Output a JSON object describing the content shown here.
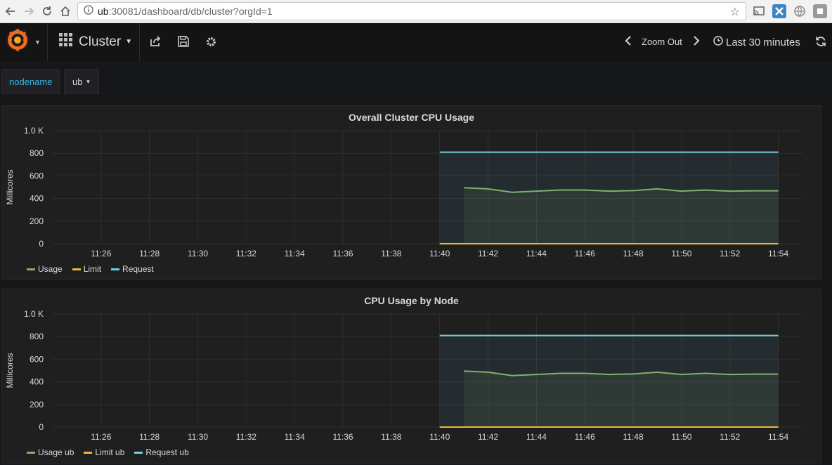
{
  "browser": {
    "url_host": "ub",
    "url_path": ":30081/dashboard/db/cluster?orgId=1"
  },
  "navbar": {
    "dashboard_title": "Cluster",
    "zoom_out_label": "Zoom Out",
    "time_range": "Last 30 minutes"
  },
  "variables": {
    "label": "nodename",
    "value": "ub"
  },
  "colors": {
    "usage": "#7eb26d",
    "limit": "#eab839",
    "request": "#6ed0e0",
    "panel_bg": "#1f1f20"
  },
  "panels": [
    {
      "title": "Overall Cluster CPU Usage",
      "legend": [
        "Usage",
        "Limit",
        "Request"
      ]
    },
    {
      "title": "CPU Usage by Node",
      "legend": [
        "Usage ub",
        "Limit ub",
        "Request ub"
      ]
    }
  ],
  "chart_data": [
    {
      "type": "line",
      "title": "Overall Cluster CPU Usage",
      "xlabel": "",
      "ylabel": "Millicores",
      "ylim": [
        0,
        1000
      ],
      "y_ticks": [
        "0",
        "200",
        "400",
        "600",
        "800",
        "1.0 K"
      ],
      "x_ticks": [
        "11:26",
        "11:28",
        "11:30",
        "11:32",
        "11:34",
        "11:36",
        "11:38",
        "11:40",
        "11:42",
        "11:44",
        "11:46",
        "11:48",
        "11:50",
        "11:52",
        "11:54"
      ],
      "x_range": [
        "11:24",
        "11:55"
      ],
      "grid": true,
      "legend_position": "bottom-left",
      "series": [
        {
          "name": "Usage",
          "x": [
            "11:41",
            "11:42",
            "11:43",
            "11:44",
            "11:45",
            "11:46",
            "11:47",
            "11:48",
            "11:49",
            "11:50",
            "11:51",
            "11:52",
            "11:53",
            "11:54"
          ],
          "values": [
            495,
            485,
            455,
            465,
            475,
            475,
            465,
            470,
            485,
            465,
            475,
            465,
            468,
            468
          ]
        },
        {
          "name": "Limit",
          "x": [
            "11:40",
            "11:54"
          ],
          "values": [
            0,
            0
          ]
        },
        {
          "name": "Request",
          "x": [
            "11:40",
            "11:54"
          ],
          "values": [
            810,
            810
          ]
        }
      ]
    },
    {
      "type": "line",
      "title": "CPU Usage by Node",
      "xlabel": "",
      "ylabel": "Millicores",
      "ylim": [
        0,
        1000
      ],
      "y_ticks": [
        "0",
        "200",
        "400",
        "600",
        "800",
        "1.0 K"
      ],
      "x_ticks": [
        "11:26",
        "11:28",
        "11:30",
        "11:32",
        "11:34",
        "11:36",
        "11:38",
        "11:40",
        "11:42",
        "11:44",
        "11:46",
        "11:48",
        "11:50",
        "11:52",
        "11:54"
      ],
      "x_range": [
        "11:24",
        "11:55"
      ],
      "grid": true,
      "legend_position": "bottom-left",
      "series": [
        {
          "name": "Usage ub",
          "x": [
            "11:41",
            "11:42",
            "11:43",
            "11:44",
            "11:45",
            "11:46",
            "11:47",
            "11:48",
            "11:49",
            "11:50",
            "11:51",
            "11:52",
            "11:53",
            "11:54"
          ],
          "values": [
            495,
            485,
            455,
            465,
            475,
            475,
            465,
            470,
            485,
            465,
            475,
            465,
            468,
            468
          ]
        },
        {
          "name": "Limit ub",
          "x": [
            "11:40",
            "11:54"
          ],
          "values": [
            0,
            0
          ]
        },
        {
          "name": "Request ub",
          "x": [
            "11:40",
            "11:54"
          ],
          "values": [
            810,
            810
          ]
        }
      ]
    }
  ]
}
